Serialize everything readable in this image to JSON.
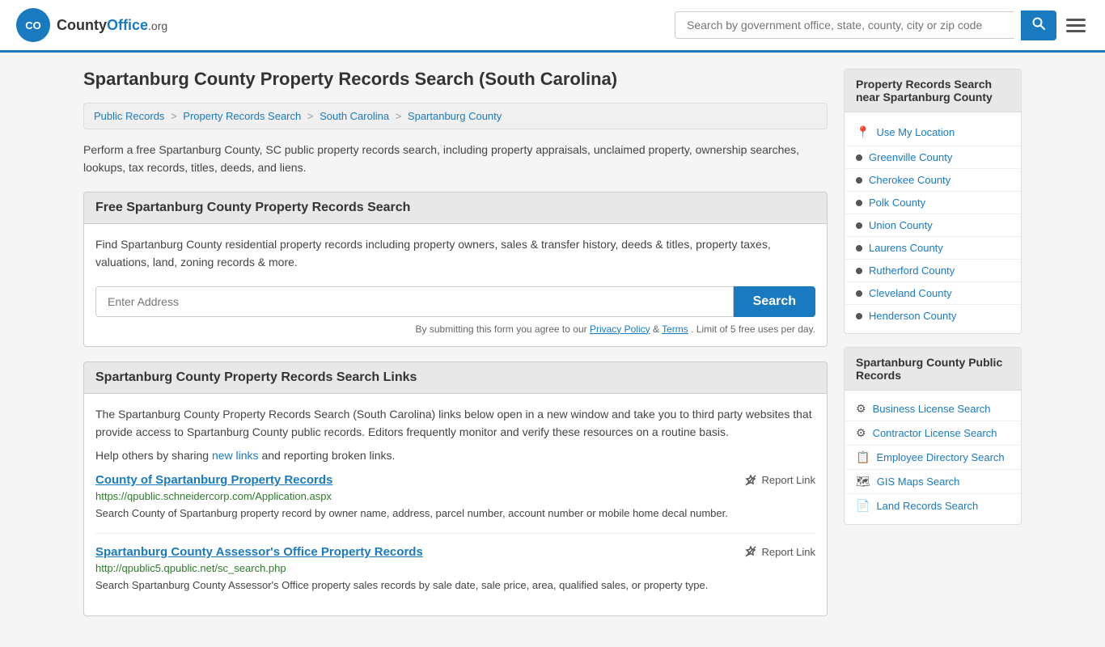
{
  "header": {
    "logo_letter": "C",
    "logo_brand": "County",
    "logo_suffix": "Office",
    "logo_tld": ".org",
    "search_placeholder": "Search by government office, state, county, city or zip code"
  },
  "page": {
    "title": "Spartanburg County Property Records Search (South Carolina)"
  },
  "breadcrumb": {
    "items": [
      {
        "label": "Public Records",
        "href": "#"
      },
      {
        "label": "Property Records Search",
        "href": "#"
      },
      {
        "label": "South Carolina",
        "href": "#"
      },
      {
        "label": "Spartanburg County",
        "href": "#"
      }
    ]
  },
  "intro": {
    "text": "Perform a free Spartanburg County, SC public property records search, including property appraisals, unclaimed property, ownership searches, lookups, tax records, titles, deeds, and liens."
  },
  "free_search": {
    "heading": "Free Spartanburg County Property Records Search",
    "description": "Find Spartanburg County residential property records including property owners, sales & transfer history, deeds & titles, property taxes, valuations, land, zoning records & more.",
    "address_placeholder": "Enter Address",
    "search_button": "Search",
    "disclaimer": "By submitting this form you agree to our",
    "privacy_label": "Privacy Policy",
    "terms_label": "Terms",
    "limit_text": ". Limit of 5 free uses per day."
  },
  "links_section": {
    "heading": "Spartanburg County Property Records Search Links",
    "description": "The Spartanburg County Property Records Search (South Carolina) links below open in a new window and take you to third party websites that provide access to Spartanburg County public records. Editors frequently monitor and verify these resources on a routine basis.",
    "share_text": "Help others by sharing",
    "share_link_label": "new links",
    "share_suffix": "and reporting broken links.",
    "resources": [
      {
        "title": "County of Spartanburg Property Records",
        "url": "https://qpublic.schneidercorp.com/Application.aspx",
        "description": "Search County of Spartanburg property record by owner name, address, parcel number, account number or mobile home decal number.",
        "report_label": "Report Link"
      },
      {
        "title": "Spartanburg County Assessor's Office Property Records",
        "url": "http://qpublic5.qpublic.net/sc_search.php",
        "description": "Search Spartanburg County Assessor's Office property sales records by sale date, sale price, area, qualified sales, or property type.",
        "report_label": "Report Link"
      }
    ]
  },
  "sidebar": {
    "nearby_heading": "Property Records Search near Spartanburg County",
    "use_location_label": "Use My Location",
    "nearby_counties": [
      "Greenville County",
      "Cherokee County",
      "Polk County",
      "Union County",
      "Laurens County",
      "Rutherford County",
      "Cleveland County",
      "Henderson County"
    ],
    "public_records_heading": "Spartanburg County Public Records",
    "public_records": [
      {
        "icon": "⚙",
        "label": "Business License Search"
      },
      {
        "icon": "⚙",
        "label": "Contractor License Search"
      },
      {
        "icon": "📋",
        "label": "Employee Directory Search"
      },
      {
        "icon": "🗺",
        "label": "GIS Maps Search"
      },
      {
        "icon": "📄",
        "label": "Land Records Search"
      }
    ]
  }
}
